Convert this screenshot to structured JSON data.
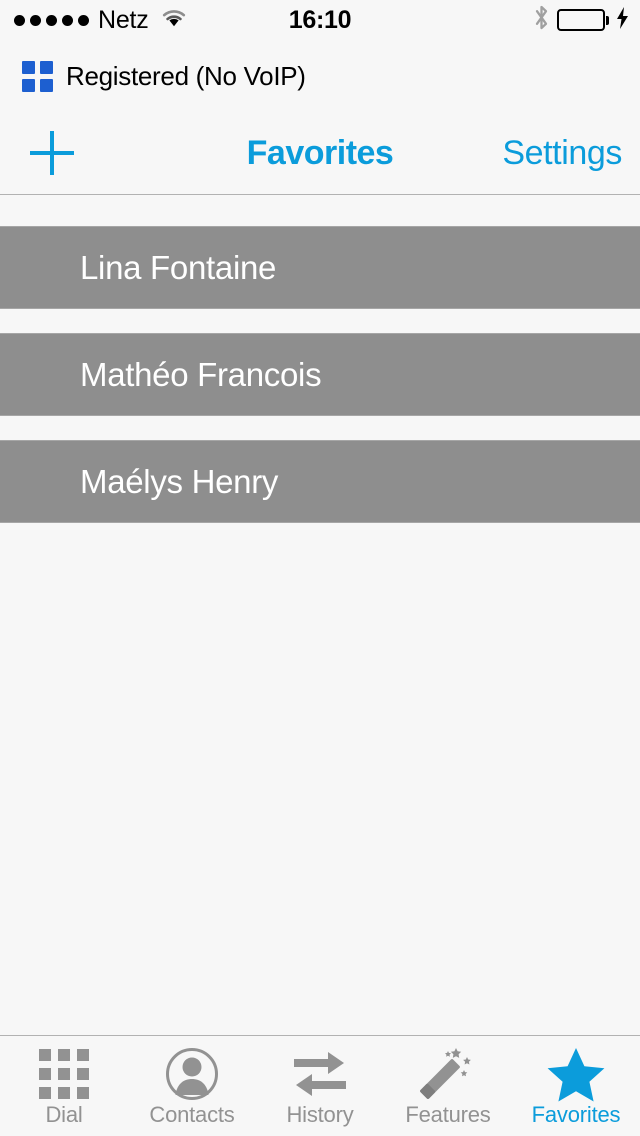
{
  "status_bar": {
    "signal_dots": 5,
    "carrier": "Netz",
    "wifi_icon": "wifi-icon",
    "time": "16:10",
    "bluetooth_icon": "bluetooth-icon",
    "battery_icon": "battery-icon",
    "charging_icon": "lightning-bolt-icon",
    "battery_color": "#4cd964"
  },
  "registration": {
    "icon": "four-squares-icon",
    "icon_color": "#1d5fd0",
    "label": "Registered (No VoIP)"
  },
  "nav_bar": {
    "add_label": "+",
    "add_icon": "plus-icon",
    "title": "Favorites",
    "settings_label": "Settings",
    "accent_color": "#0b9cdb"
  },
  "favorites": {
    "row_color": "#8e8e8e",
    "text_color": "#ffffff",
    "items": [
      {
        "name": "Lina Fontaine"
      },
      {
        "name": "Mathéo Francois"
      },
      {
        "name": "Maélys Henry"
      }
    ]
  },
  "tab_bar": {
    "active_color": "#0b9cdb",
    "inactive_color": "#929292",
    "tabs": [
      {
        "label": "Dial",
        "icon": "keypad-icon",
        "active": false
      },
      {
        "label": "Contacts",
        "icon": "person-circle-icon",
        "active": false
      },
      {
        "label": "History",
        "icon": "two-arrows-icon",
        "active": false
      },
      {
        "label": "Features",
        "icon": "magic-wand-icon",
        "active": false
      },
      {
        "label": "Favorites",
        "icon": "star-icon",
        "active": true
      }
    ]
  }
}
